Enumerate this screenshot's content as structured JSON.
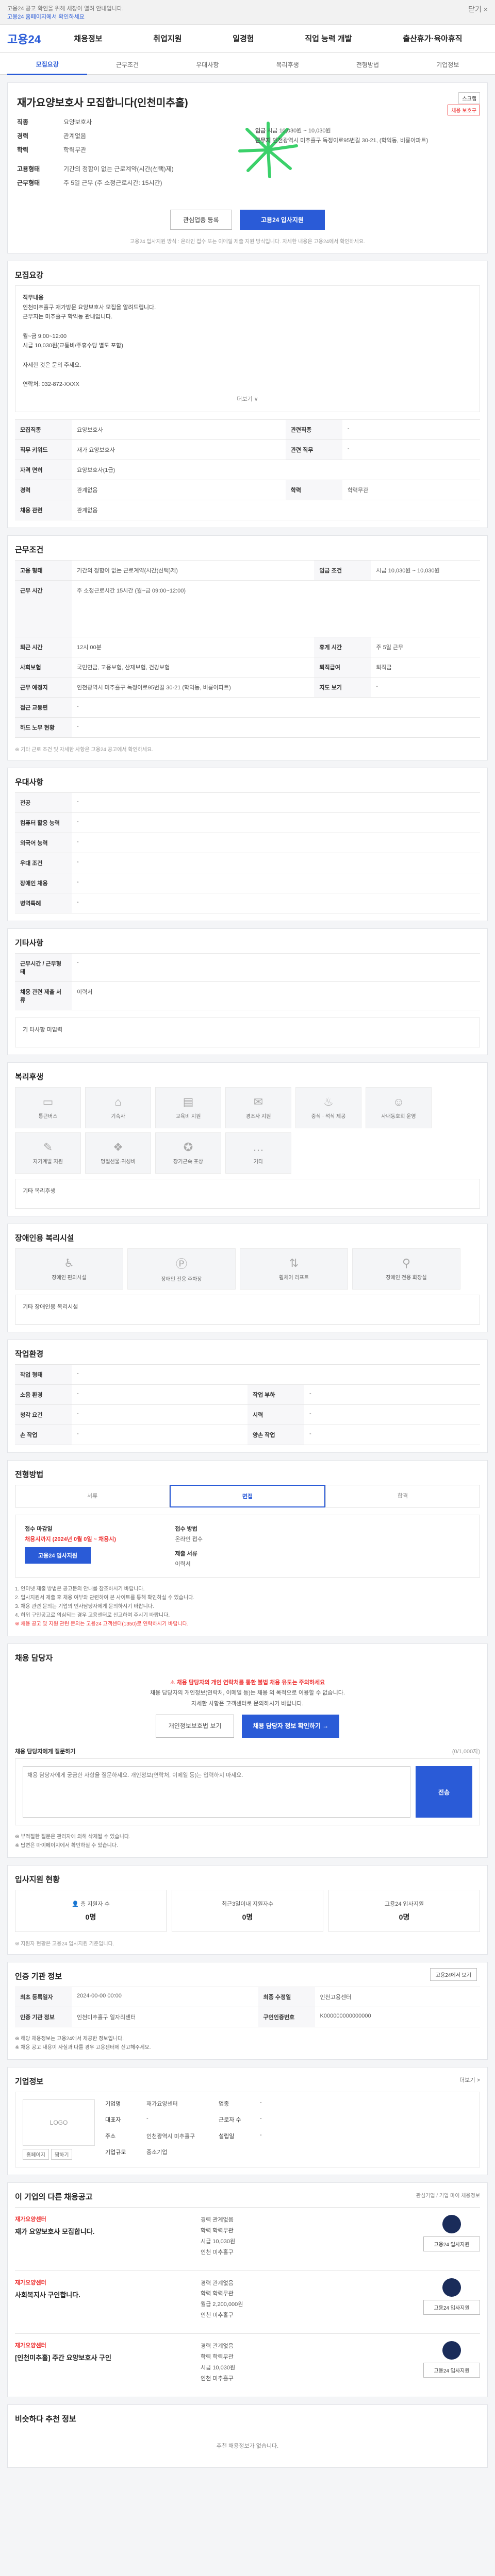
{
  "topbar": {
    "notice": "고용24 공고 확인을 위해 새창이 열려 안내입니다.",
    "link": "고용24 홈페이지에서 확인하세요",
    "close": "닫기 ×"
  },
  "gnb": {
    "logo": "고용24",
    "menus": [
      "채용정보",
      "취업지원",
      "일경험",
      "직업 능력 개발",
      "출산휴가·육아휴직"
    ]
  },
  "tabs": [
    "모집요강",
    "근무조건",
    "우대사항",
    "복리후생",
    "전형방법",
    "기업정보"
  ],
  "job": {
    "title": "재가요양보호사 모집합니다(인천미추홀)",
    "btn_scrap": "스크랩",
    "badge": "채용 보호구",
    "info": [
      [
        "직종",
        "요양보호사"
      ],
      [
        "경력",
        "관계없음"
      ],
      [
        "학력",
        "학력무관"
      ]
    ],
    "cond": [
      [
        "고용형태",
        "기간의 정함이 없는 근로계약(시간(선택)제)"
      ],
      [
        "근무형태",
        "주 5일 근무 (주 소정근로시간: 15시간)"
      ]
    ],
    "wage_label": "임금",
    "wage": "시급 10,030원 ~ 10,030원",
    "addr_label": "근무지",
    "addr": "인천광역시 미추홀구 독정이로95번길 30-21, (학익동, 비룡아파트)",
    "btn_interest": "관심업종 등록",
    "btn_apply": "고용24 입사지원",
    "hint": "고용24 입사지원 방식 : 온라인 접수 또는 이메일 제출 지원 방식입니다. 자세한 내용은 고용24에서 확인하세요."
  },
  "recruit": {
    "title": "모집요강",
    "detail_label": "직무내용",
    "detail": [
      "인천미추홀구 재가방문 요양보호사 모집을 알려드립니다.",
      "근무지는 미추홀구 학익동 관내입니다.",
      "월~금 9:00~12:00",
      "시급 10,030원(교통비/주휴수당 별도 포함)",
      "자세한 것은 문의 주세요.",
      "연락처: 032-872-XXXX"
    ],
    "more": "더보기 ∨",
    "rows": [
      [
        "모집직종",
        "요양보호사",
        "관련직종",
        "-"
      ],
      [
        "직무 키워드",
        "재가 요양보호사",
        "관련 직무",
        "-"
      ],
      [
        "자격 면허",
        "요양보호사(1급)",
        "",
        ""
      ],
      [
        "경력",
        "관계없음",
        "학력",
        "학력무관"
      ],
      [
        "채용 관련",
        "관계없음",
        "",
        ""
      ]
    ]
  },
  "work": {
    "title": "근무조건",
    "rows": [
      [
        "고용 형태",
        "기간의 정함이 없는 근로계약(시간(선택)제)",
        "임금 조건",
        "시급 10,030원 ~ 10,030원"
      ],
      [
        "근무 시간",
        "주 소정근로시간 15시간 (월~금 09:00~12:00)",
        "",
        ""
      ],
      [
        "퇴근 시간",
        "12시 00분",
        "휴게 시간",
        "주 5일 근무"
      ],
      [
        "사회보험",
        "국민연금, 고용보험, 산재보험, 건강보험",
        "퇴직급여",
        "퇴직금"
      ],
      [
        "근무 예정지",
        "인천광역시 미추홀구 독정이로95번길 30-21 (학익동, 비룡아파트)",
        "지도 보기",
        "-"
      ],
      [
        "접근 교통편",
        "-",
        "",
        ""
      ],
      [
        "하드 노무 현황",
        "-",
        "",
        ""
      ]
    ],
    "note": "※ 기타 근로 조건 및 자세한 사항은 고용24 공고에서 확인하세요."
  },
  "pref": {
    "title": "우대사항",
    "rows": [
      [
        "전공",
        "-"
      ],
      [
        "컴퓨터 활용 능력",
        "-"
      ],
      [
        "외국어 능력",
        "-"
      ],
      [
        "우대 조건",
        "-"
      ],
      [
        "장애인 채용",
        "-"
      ],
      [
        "병역특례",
        "-"
      ]
    ]
  },
  "etc": {
    "title": "기타사항",
    "rows": [
      [
        "근무시간 / 근무형태",
        "-"
      ],
      [
        "채용 관련 제출 서류",
        "이력서"
      ]
    ],
    "box": "기 타사항 미입력"
  },
  "welfare": {
    "title": "복리후생",
    "icons": [
      "통근버스",
      "기숙사",
      "교육비 지원",
      "경조사 지원",
      "중식 · 석식 제공",
      "사내동호회 운영",
      "자기계발 지원",
      "명절선물·귀성비",
      "장기근속 포상",
      "기타"
    ],
    "box": "기타 복리후생"
  },
  "facility": {
    "title": "장애인용 복리시설",
    "icons": [
      "장애인 편의시설",
      "장애인 전용 주차장",
      "휠체어 리프트",
      "장애인 전용 화장실"
    ],
    "box": "기타 장애인용 복리시설"
  },
  "env": {
    "title": "작업환경",
    "rows": [
      [
        "작업 형태",
        "-",
        "",
        ""
      ],
      [
        "소음 환경",
        "-",
        "작업 부하",
        "-"
      ],
      [
        "청각 요건",
        "-",
        "시력",
        "-"
      ],
      [
        "손 작업",
        "-",
        "양손 작업",
        "-"
      ]
    ]
  },
  "process": {
    "title": "전형방법",
    "steps": [
      "서류",
      "면접",
      "합격"
    ],
    "apply_k": "접수 마감일",
    "apply_v": "채용시까지 (2024년 0월 0일 ~ 채용시)",
    "apply_btn": "고용24 입사지원",
    "method_k": "접수 방법",
    "method_v": "온라인 접수",
    "docs_k": "제출 서류",
    "docs_v": "이력서",
    "notes": [
      "1. 인터넷 제출 방법은 공고문의 안내를 참조하시기 바랍니다.",
      "2. 입사지원서 제출 후 채용 여부와 관련하여 본 사이트를 통해 확인하실 수 있습니다.",
      "3. 채용 관련 문의는 기업의 인사담당자에게 문의하시기 바랍니다.",
      "4. 허위 구인공고로 의심되는 경우 고용센터로 신고하여 주시기 바랍니다."
    ],
    "notes_red": "※ 채용 공고 및 지원 관련 문의는 고용24 고객센터(1350)로 연락하시기 바랍니다."
  },
  "manager": {
    "title": "채용 담당자",
    "warn_t": "채용 담당자의 개인 연락처를 통한 불법 채용 유도는 주의하세요",
    "warn_b": "채용 담당자의 개인정보(연락처, 이메일 등)는 채용 외 목적으로 이용할 수 없습니다.",
    "warn_c": "자세한 사항은 고객센터로 문의하시기 바랍니다.",
    "btn_a": "개인정보보호법 보기",
    "btn_b": "채용 담당자 정보 확인하기 →",
    "ask_label": "채용 담당자에게 질문하기",
    "ask_hint": "(0/1,000자)",
    "ask_ph": "채용 담당자에게 궁금한 사항을 질문하세요. 개인정보(연락처, 이메일 등)는 입력하지 마세요.",
    "ask_send": "전송",
    "ask_notes": [
      "※ 부적절한 질문은 관리자에 의해 삭제될 수 있습니다.",
      "※ 답변은 마이페이지에서 확인하실 수 있습니다."
    ]
  },
  "status": {
    "title": "입사지원 현황",
    "items": [
      [
        "총 지원자 수",
        "0명"
      ],
      [
        "최근3일이내 지원자수",
        "0명"
      ],
      [
        "고용24 입사지원",
        "0명"
      ]
    ],
    "note": "※ 지원자 현황은 고용24 입사지원 기준입니다."
  },
  "info": {
    "title": "인증 기관 정보",
    "btn": "고용24에서 보기",
    "rows": [
      [
        "최초 등록일자",
        "2024-00-00 00:00",
        "최종 수정일",
        "인천고용센터"
      ],
      [
        "인증 기관 정보",
        "인천미추홀구 일자리센터",
        "구인인증번호",
        "K000000000000000"
      ]
    ],
    "notes": [
      "※ 해당 채용정보는 고용24에서 제공한 정보입니다.",
      "※ 채용 공고 내용이 사실과 다를 경우 고용센터에 신고해주세요."
    ]
  },
  "company": {
    "title": "기업정보",
    "more": "더보기 >",
    "logo": "LOGO",
    "mini": [
      "홈페이지",
      "찜하기"
    ],
    "rows": [
      [
        "기업명",
        "재가요양센터",
        "업종",
        "-"
      ],
      [
        "대표자",
        "-",
        "근로자 수",
        "-"
      ],
      [
        "주소",
        "인천광역시 미추홀구",
        "설립일",
        "-"
      ],
      [
        "기업규모",
        "중소기업",
        "",
        ""
      ]
    ]
  },
  "others": {
    "title": "이 기업의 다른 채용공고",
    "right": "관심기업 / 기업 마이 채용정보",
    "jobs": [
      {
        "co": "재가요양센터",
        "title": "재가 요양보호사 모집합니다.",
        "meta": [
          "경력 관계없음",
          "학력 학력무관",
          "시급 10,030원",
          "인천 미추홀구"
        ],
        "btn": "고용24 입사지원"
      },
      {
        "co": "재가요양센터",
        "title": "사회복지사 구인합니다.",
        "meta": [
          "경력 관계없음",
          "학력 학력무관",
          "월급 2,200,000원",
          "인천 미추홀구"
        ],
        "btn": "고용24 입사지원"
      },
      {
        "co": "재가요양센터",
        "title": "[인천미추홀] 주간 요양보호사 구인",
        "meta": [
          "경력 관계없음",
          "학력 학력무관",
          "시급 10,030원",
          "인천 미추홀구"
        ],
        "btn": "고용24 입사지원"
      }
    ]
  },
  "recent": {
    "title": "비슷하다 추천 정보",
    "empty": "추천 채용정보가 없습니다."
  }
}
